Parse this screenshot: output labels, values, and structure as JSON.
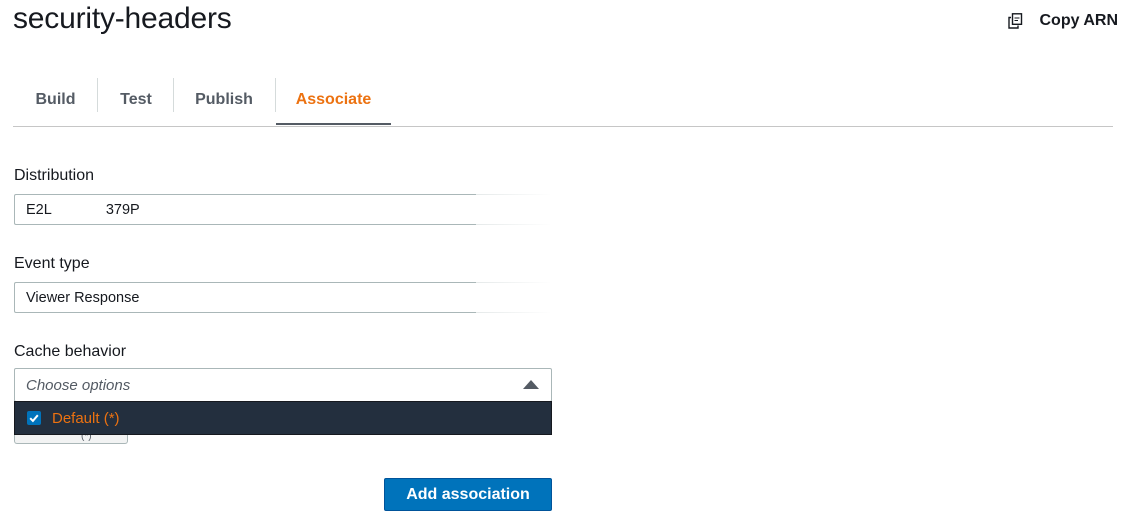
{
  "header": {
    "title": "security-headers",
    "copy_arn_label": "Copy ARN",
    "copy_icon": "copy-icon"
  },
  "tabs": [
    {
      "label": "Build"
    },
    {
      "label": "Test"
    },
    {
      "label": "Publish"
    },
    {
      "label": "Associate",
      "active": true
    }
  ],
  "form": {
    "distribution": {
      "label": "Distribution",
      "value_visible_start": "E2L",
      "value_visible_end": "379P"
    },
    "event_type": {
      "label": "Event type",
      "value": "Viewer Response"
    },
    "cache_behavior": {
      "label": "Cache behavior",
      "placeholder": "Choose options",
      "options": [
        {
          "label": "Default (*)",
          "checked": true
        }
      ]
    },
    "submit_label": "Add association"
  },
  "colors": {
    "accent": "#ec7211",
    "primary": "#0073bb",
    "dropdown_bg": "#232f3e"
  }
}
